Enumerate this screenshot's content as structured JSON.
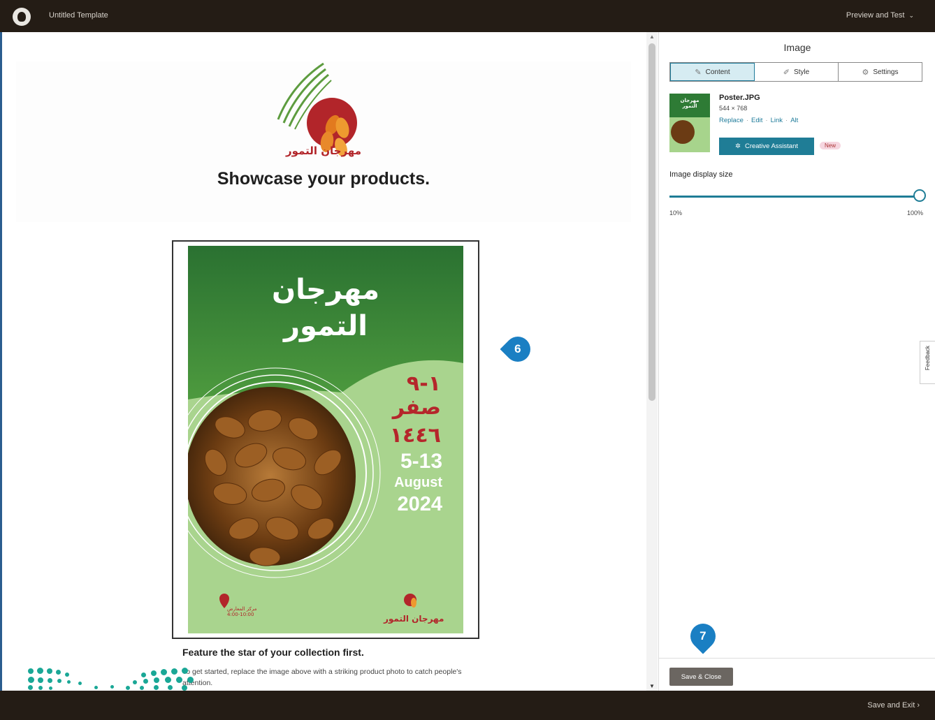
{
  "topbar": {
    "title": "Untitled Template",
    "preview_label": "Preview and Test",
    "preview_icon": "chevron-down-icon"
  },
  "canvas": {
    "brand_name": "مهرجان التمور",
    "headline": "Showcase your products.",
    "poster": {
      "title_line1": "مهرجان",
      "title_line2": "التمور",
      "hijri_days": "١-٩",
      "hijri_month": "صفر",
      "hijri_year": "١٤٤٦",
      "greg_days": "5-13",
      "greg_month": "August",
      "greg_year": "2024",
      "venue_name": "مركز المعارض",
      "venue_hours": "4:00-10:00",
      "footer_brand": "مهرجان التمور"
    },
    "feature_title": "Feature the star of your collection first.",
    "feature_body": "To get started, replace the image above with a striking product photo to catch people's attention."
  },
  "panel": {
    "title": "Image",
    "tabs": [
      {
        "label": "Content",
        "icon": "pencil-icon",
        "active": true
      },
      {
        "label": "Style",
        "icon": "brush-icon",
        "active": false
      },
      {
        "label": "Settings",
        "icon": "gear-icon",
        "active": false
      }
    ],
    "file": {
      "name": "Poster.JPG",
      "dimensions": "544 × 768",
      "links": [
        "Replace",
        "Edit",
        "Link",
        "Alt"
      ]
    },
    "creative_assistant_label": "Creative Assistant",
    "new_badge": "New",
    "display_size_label": "Image display size",
    "slider_min": "10%",
    "slider_max": "100%",
    "slider_value": 1.0,
    "feedback_label": "Feedback",
    "save_close_label": "Save & Close"
  },
  "bottombar": {
    "save_exit_label": "Save and Exit ›"
  },
  "markers": {
    "m6": "6",
    "m7": "7"
  },
  "colors": {
    "topbar": "#241c15",
    "accent_teal": "#1f7d96",
    "brand_red": "#b2252a",
    "poster_green": "#2e7b35",
    "poster_light_green": "#a9d48e",
    "marker_blue": "#1a7fc3"
  }
}
